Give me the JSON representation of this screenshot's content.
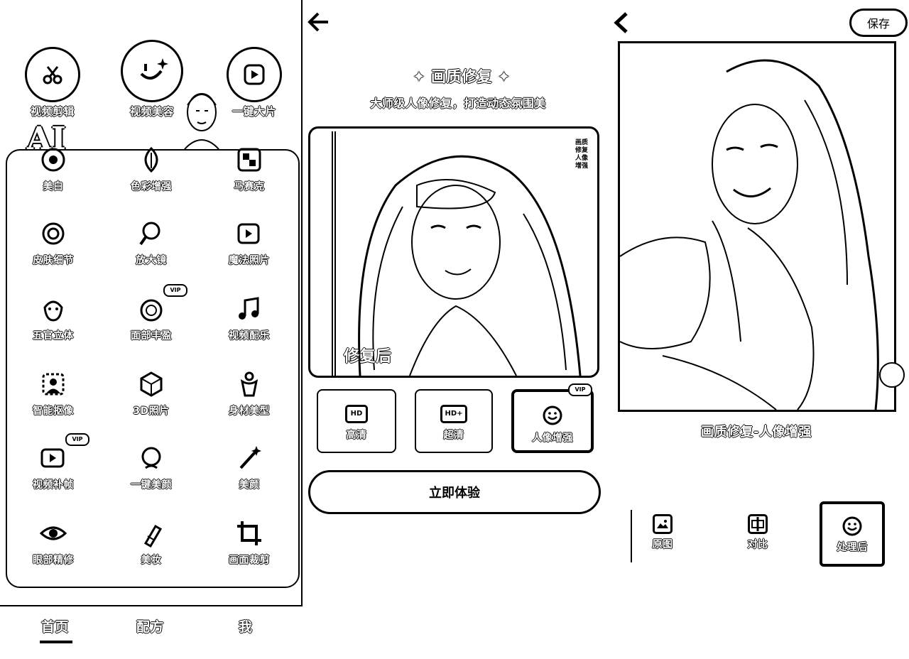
{
  "panel_home": {
    "top_tools": [
      {
        "label": "视频剪辑",
        "icon": "scissors-icon"
      },
      {
        "label": "视频美容",
        "icon": "sparkle-face-icon"
      },
      {
        "label": "一键大片",
        "icon": "play-icon"
      }
    ],
    "badge_text": "AI",
    "tools": [
      {
        "label": "美白",
        "icon": "whitening-icon"
      },
      {
        "label": "色彩增强",
        "icon": "leaf-icon"
      },
      {
        "label": "马赛克",
        "icon": "mosaic-icon"
      },
      {
        "label": "皮肤细节",
        "icon": "skin-detail-icon"
      },
      {
        "label": "放大镜",
        "icon": "magnifier-icon"
      },
      {
        "label": "魔法照片",
        "icon": "magic-photo-icon"
      },
      {
        "label": "五官立体",
        "icon": "face-contour-icon"
      },
      {
        "label": "面部丰盈",
        "icon": "face-fill-icon",
        "tag": "VIP"
      },
      {
        "label": "视频配乐",
        "icon": "music-note-icon"
      },
      {
        "label": "智能抠像",
        "icon": "cutout-icon"
      },
      {
        "label": "3D照片",
        "icon": "cube-icon"
      },
      {
        "label": "身材美型",
        "icon": "body-shape-icon"
      },
      {
        "label": "视频补帧",
        "icon": "video-frame-icon",
        "tag": "VIP"
      },
      {
        "label": "一键美颜",
        "icon": "beauty-face-icon"
      },
      {
        "label": "美颜",
        "icon": "wand-icon"
      },
      {
        "label": "眼部精修",
        "icon": "eye-icon"
      },
      {
        "label": "美妆",
        "icon": "lipstick-icon"
      },
      {
        "label": "画面裁剪",
        "icon": "crop-icon"
      }
    ],
    "nav": [
      {
        "label": "首页",
        "active": true
      },
      {
        "label": "配方",
        "active": false
      },
      {
        "label": "我",
        "active": false
      }
    ]
  },
  "panel_restore": {
    "title": "画质修复",
    "subtitle": "大师级人像修复，打造动态氛围美",
    "after_label": "修复后",
    "side_note": "画质修复人像增强",
    "options": [
      {
        "label": "高清",
        "icon_text": "HD",
        "selected": false
      },
      {
        "label": "超清",
        "icon_text": "HD+",
        "selected": false
      },
      {
        "label": "人像增强",
        "icon_text": "",
        "selected": true,
        "tag": "VIP"
      }
    ],
    "try_button": "立即体验"
  },
  "panel_result": {
    "save_button": "保存",
    "caption": "画质修复-人像增强",
    "view_options": [
      {
        "label": "原图",
        "icon": "image-icon",
        "selected": false
      },
      {
        "label": "对比",
        "icon": "split-compare-icon",
        "selected": false
      },
      {
        "label": "处理后",
        "icon": "smile-icon",
        "selected": true
      }
    ]
  },
  "colors": {
    "ink": "#000000",
    "paper": "#ffffff"
  }
}
